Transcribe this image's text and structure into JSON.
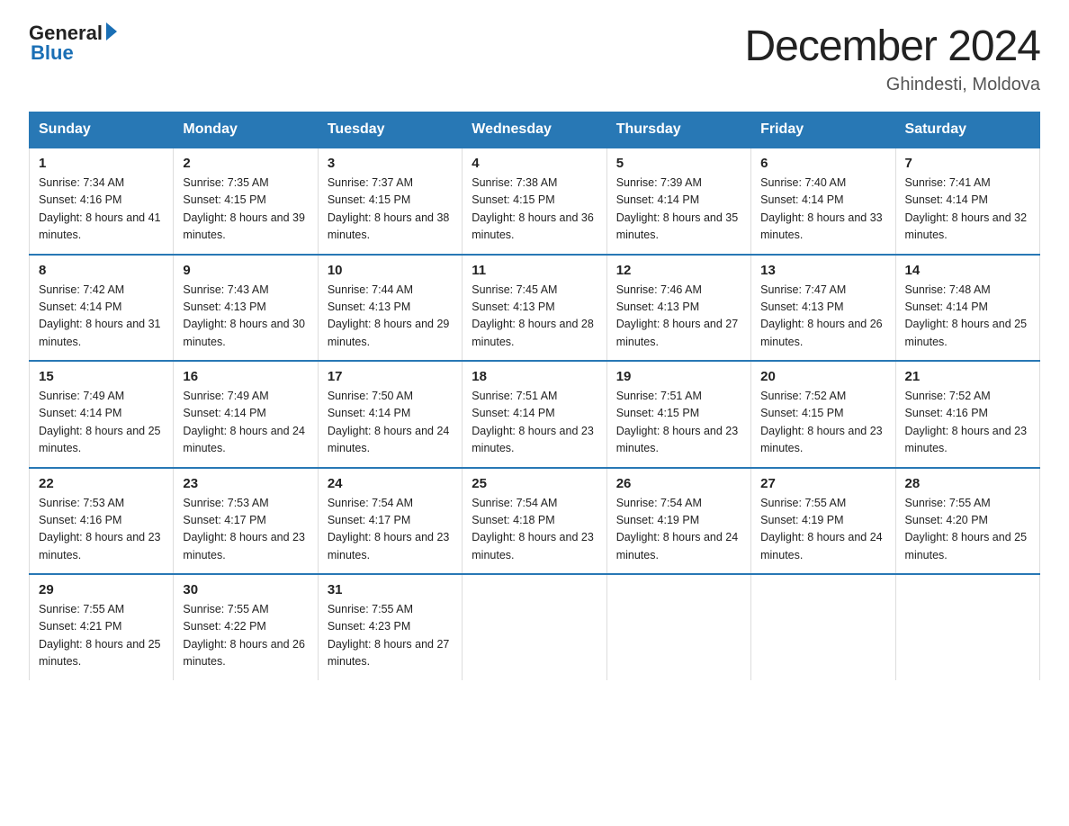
{
  "header": {
    "logo_general": "General",
    "logo_blue": "Blue",
    "month_title": "December 2024",
    "location": "Ghindesti, Moldova"
  },
  "columns": [
    "Sunday",
    "Monday",
    "Tuesday",
    "Wednesday",
    "Thursday",
    "Friday",
    "Saturday"
  ],
  "weeks": [
    [
      {
        "day": "1",
        "sunrise": "7:34 AM",
        "sunset": "4:16 PM",
        "daylight": "8 hours and 41 minutes."
      },
      {
        "day": "2",
        "sunrise": "7:35 AM",
        "sunset": "4:15 PM",
        "daylight": "8 hours and 39 minutes."
      },
      {
        "day": "3",
        "sunrise": "7:37 AM",
        "sunset": "4:15 PM",
        "daylight": "8 hours and 38 minutes."
      },
      {
        "day": "4",
        "sunrise": "7:38 AM",
        "sunset": "4:15 PM",
        "daylight": "8 hours and 36 minutes."
      },
      {
        "day": "5",
        "sunrise": "7:39 AM",
        "sunset": "4:14 PM",
        "daylight": "8 hours and 35 minutes."
      },
      {
        "day": "6",
        "sunrise": "7:40 AM",
        "sunset": "4:14 PM",
        "daylight": "8 hours and 33 minutes."
      },
      {
        "day": "7",
        "sunrise": "7:41 AM",
        "sunset": "4:14 PM",
        "daylight": "8 hours and 32 minutes."
      }
    ],
    [
      {
        "day": "8",
        "sunrise": "7:42 AM",
        "sunset": "4:14 PM",
        "daylight": "8 hours and 31 minutes."
      },
      {
        "day": "9",
        "sunrise": "7:43 AM",
        "sunset": "4:13 PM",
        "daylight": "8 hours and 30 minutes."
      },
      {
        "day": "10",
        "sunrise": "7:44 AM",
        "sunset": "4:13 PM",
        "daylight": "8 hours and 29 minutes."
      },
      {
        "day": "11",
        "sunrise": "7:45 AM",
        "sunset": "4:13 PM",
        "daylight": "8 hours and 28 minutes."
      },
      {
        "day": "12",
        "sunrise": "7:46 AM",
        "sunset": "4:13 PM",
        "daylight": "8 hours and 27 minutes."
      },
      {
        "day": "13",
        "sunrise": "7:47 AM",
        "sunset": "4:13 PM",
        "daylight": "8 hours and 26 minutes."
      },
      {
        "day": "14",
        "sunrise": "7:48 AM",
        "sunset": "4:14 PM",
        "daylight": "8 hours and 25 minutes."
      }
    ],
    [
      {
        "day": "15",
        "sunrise": "7:49 AM",
        "sunset": "4:14 PM",
        "daylight": "8 hours and 25 minutes."
      },
      {
        "day": "16",
        "sunrise": "7:49 AM",
        "sunset": "4:14 PM",
        "daylight": "8 hours and 24 minutes."
      },
      {
        "day": "17",
        "sunrise": "7:50 AM",
        "sunset": "4:14 PM",
        "daylight": "8 hours and 24 minutes."
      },
      {
        "day": "18",
        "sunrise": "7:51 AM",
        "sunset": "4:14 PM",
        "daylight": "8 hours and 23 minutes."
      },
      {
        "day": "19",
        "sunrise": "7:51 AM",
        "sunset": "4:15 PM",
        "daylight": "8 hours and 23 minutes."
      },
      {
        "day": "20",
        "sunrise": "7:52 AM",
        "sunset": "4:15 PM",
        "daylight": "8 hours and 23 minutes."
      },
      {
        "day": "21",
        "sunrise": "7:52 AM",
        "sunset": "4:16 PM",
        "daylight": "8 hours and 23 minutes."
      }
    ],
    [
      {
        "day": "22",
        "sunrise": "7:53 AM",
        "sunset": "4:16 PM",
        "daylight": "8 hours and 23 minutes."
      },
      {
        "day": "23",
        "sunrise": "7:53 AM",
        "sunset": "4:17 PM",
        "daylight": "8 hours and 23 minutes."
      },
      {
        "day": "24",
        "sunrise": "7:54 AM",
        "sunset": "4:17 PM",
        "daylight": "8 hours and 23 minutes."
      },
      {
        "day": "25",
        "sunrise": "7:54 AM",
        "sunset": "4:18 PM",
        "daylight": "8 hours and 23 minutes."
      },
      {
        "day": "26",
        "sunrise": "7:54 AM",
        "sunset": "4:19 PM",
        "daylight": "8 hours and 24 minutes."
      },
      {
        "day": "27",
        "sunrise": "7:55 AM",
        "sunset": "4:19 PM",
        "daylight": "8 hours and 24 minutes."
      },
      {
        "day": "28",
        "sunrise": "7:55 AM",
        "sunset": "4:20 PM",
        "daylight": "8 hours and 25 minutes."
      }
    ],
    [
      {
        "day": "29",
        "sunrise": "7:55 AM",
        "sunset": "4:21 PM",
        "daylight": "8 hours and 25 minutes."
      },
      {
        "day": "30",
        "sunrise": "7:55 AM",
        "sunset": "4:22 PM",
        "daylight": "8 hours and 26 minutes."
      },
      {
        "day": "31",
        "sunrise": "7:55 AM",
        "sunset": "4:23 PM",
        "daylight": "8 hours and 27 minutes."
      },
      null,
      null,
      null,
      null
    ]
  ]
}
